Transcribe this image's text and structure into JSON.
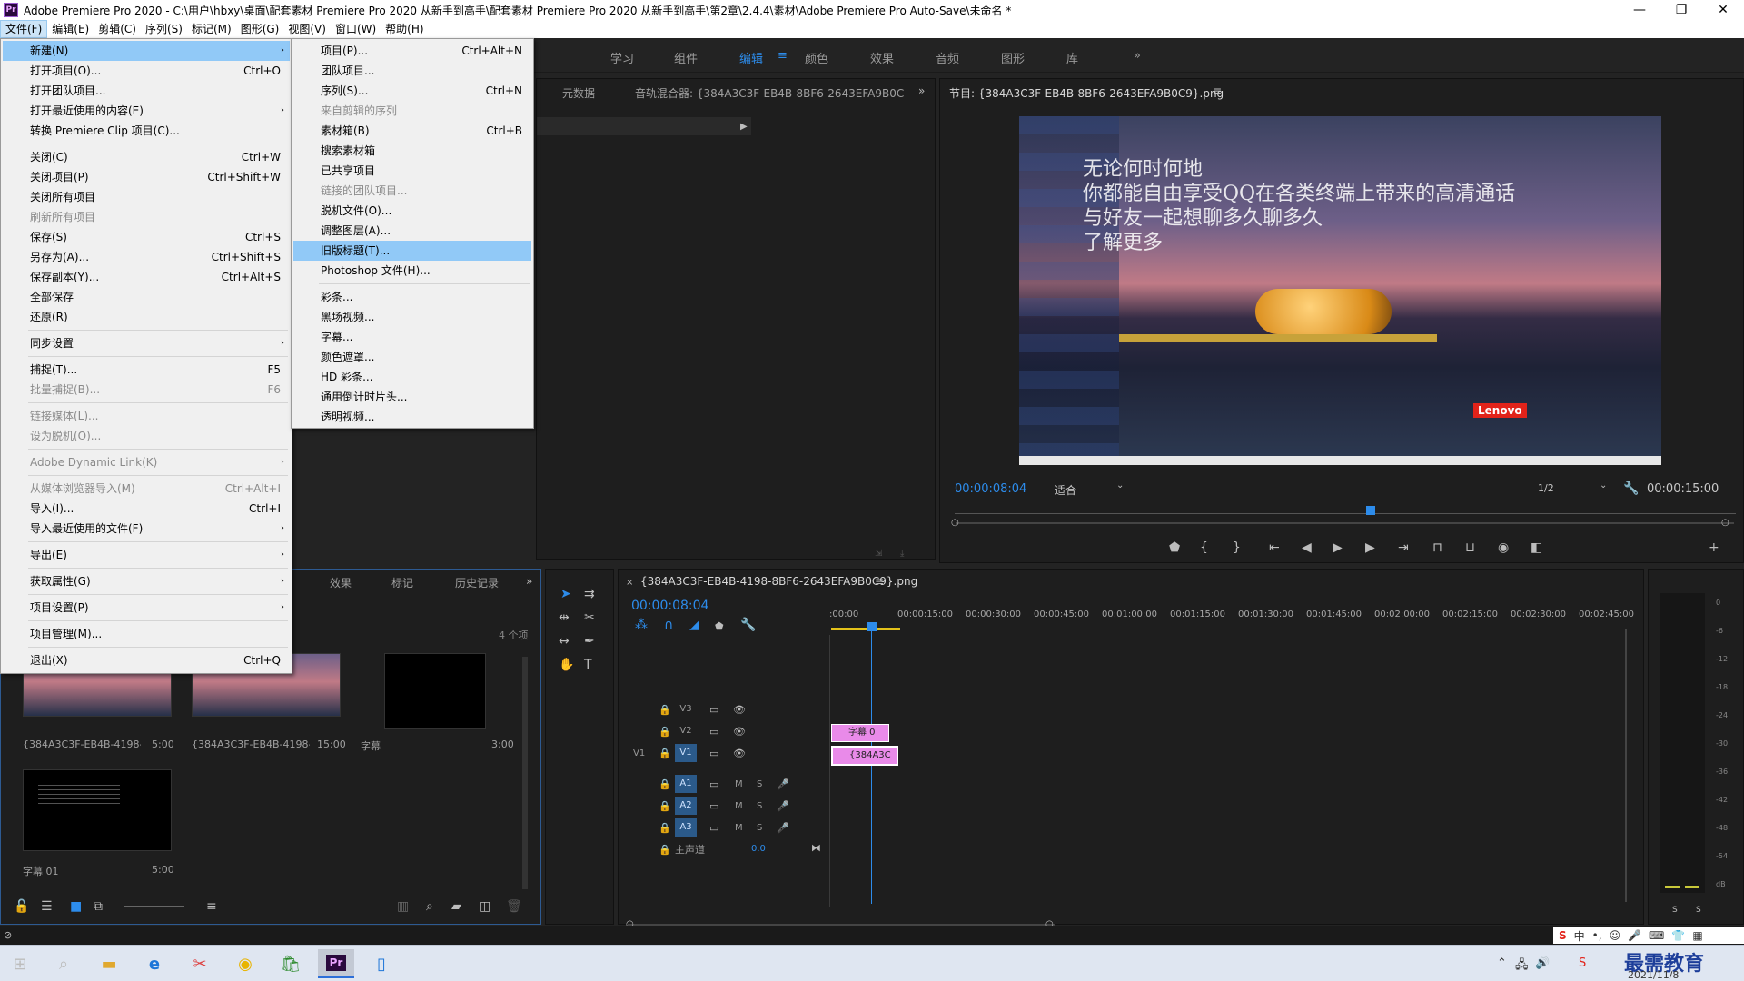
{
  "window": {
    "title": "Adobe Premiere Pro 2020 - C:\\用户\\hbxy\\桌面\\配套素材 Premiere Pro 2020 从新手到高手\\配套素材 Premiere Pro 2020 从新手到高手\\第2章\\2.4.4\\素材\\Adobe Premiere Pro Auto-Save\\未命名 *",
    "app_icon": "Pr",
    "minimize": "—",
    "maximize": "❐",
    "close": "✕"
  },
  "menubar": [
    "文件(F)",
    "编辑(E)",
    "剪辑(C)",
    "序列(S)",
    "标记(M)",
    "图形(G)",
    "视图(V)",
    "窗口(W)",
    "帮助(H)"
  ],
  "workspaces": [
    "学习",
    "组件",
    "编辑",
    "颜色",
    "效果",
    "音频",
    "图形",
    "库"
  ],
  "workspace_more": "»",
  "file_menu": [
    {
      "label": "新建(N)",
      "shortcut": "",
      "arrow": true,
      "state": "hl"
    },
    {
      "label": "打开项目(O)...",
      "shortcut": "Ctrl+O"
    },
    {
      "label": "打开团队项目...",
      "shortcut": ""
    },
    {
      "label": "打开最近使用的内容(E)",
      "shortcut": "",
      "arrow": true
    },
    {
      "label": "转换 Premiere Clip 项目(C)...",
      "shortcut": ""
    },
    {
      "sep": true
    },
    {
      "label": "关闭(C)",
      "shortcut": "Ctrl+W"
    },
    {
      "label": "关闭项目(P)",
      "shortcut": "Ctrl+Shift+W"
    },
    {
      "label": "关闭所有项目",
      "shortcut": ""
    },
    {
      "label": "刷新所有项目",
      "shortcut": "",
      "state": "dis"
    },
    {
      "label": "保存(S)",
      "shortcut": "Ctrl+S"
    },
    {
      "label": "另存为(A)...",
      "shortcut": "Ctrl+Shift+S"
    },
    {
      "label": "保存副本(Y)...",
      "shortcut": "Ctrl+Alt+S"
    },
    {
      "label": "全部保存",
      "shortcut": ""
    },
    {
      "label": "还原(R)",
      "shortcut": ""
    },
    {
      "sep": true
    },
    {
      "label": "同步设置",
      "shortcut": "",
      "arrow": true
    },
    {
      "sep": true
    },
    {
      "label": "捕捉(T)...",
      "shortcut": "F5"
    },
    {
      "label": "批量捕捉(B)...",
      "shortcut": "F6",
      "state": "dis"
    },
    {
      "sep": true
    },
    {
      "label": "链接媒体(L)...",
      "shortcut": "",
      "state": "dis"
    },
    {
      "label": "设为脱机(O)...",
      "shortcut": "",
      "state": "dis"
    },
    {
      "sep": true
    },
    {
      "label": "Adobe Dynamic Link(K)",
      "shortcut": "",
      "arrow": true,
      "state": "dis"
    },
    {
      "sep": true
    },
    {
      "label": "从媒体浏览器导入(M)",
      "shortcut": "Ctrl+Alt+I",
      "state": "dis"
    },
    {
      "label": "导入(I)...",
      "shortcut": "Ctrl+I"
    },
    {
      "label": "导入最近使用的文件(F)",
      "shortcut": "",
      "arrow": true
    },
    {
      "sep": true
    },
    {
      "label": "导出(E)",
      "shortcut": "",
      "arrow": true
    },
    {
      "sep": true
    },
    {
      "label": "获取属性(G)",
      "shortcut": "",
      "arrow": true
    },
    {
      "sep": true
    },
    {
      "label": "项目设置(P)",
      "shortcut": "",
      "arrow": true
    },
    {
      "sep": true
    },
    {
      "label": "项目管理(M)...",
      "shortcut": ""
    },
    {
      "sep": true
    },
    {
      "label": "退出(X)",
      "shortcut": "Ctrl+Q"
    }
  ],
  "new_submenu": [
    {
      "label": "项目(P)...",
      "shortcut": "Ctrl+Alt+N"
    },
    {
      "label": "团队项目...",
      "shortcut": ""
    },
    {
      "label": "序列(S)...",
      "shortcut": "Ctrl+N"
    },
    {
      "label": "来自剪辑的序列",
      "shortcut": "",
      "state": "dis"
    },
    {
      "label": "素材箱(B)",
      "shortcut": "Ctrl+B"
    },
    {
      "label": "搜索素材箱",
      "shortcut": ""
    },
    {
      "label": "已共享项目",
      "shortcut": ""
    },
    {
      "label": "链接的团队项目...",
      "shortcut": "",
      "state": "dis"
    },
    {
      "label": "脱机文件(O)...",
      "shortcut": ""
    },
    {
      "label": "调整图层(A)...",
      "shortcut": ""
    },
    {
      "label": "旧版标题(T)...",
      "shortcut": "",
      "state": "hl"
    },
    {
      "label": "Photoshop 文件(H)...",
      "shortcut": ""
    },
    {
      "sep": true
    },
    {
      "label": "彩条...",
      "shortcut": ""
    },
    {
      "label": "黑场视频...",
      "shortcut": ""
    },
    {
      "label": "字幕...",
      "shortcut": ""
    },
    {
      "label": "颜色遮罩...",
      "shortcut": ""
    },
    {
      "label": "HD 彩条...",
      "shortcut": ""
    },
    {
      "label": "通用倒计时片头...",
      "shortcut": ""
    },
    {
      "label": "透明视频...",
      "shortcut": ""
    }
  ],
  "source_panel": {
    "tabs": [
      "元数据",
      "音轨混合器: {384A3C3F-EB4B-8BF6-2643EFA9B0C"
    ]
  },
  "program": {
    "title": "节目: {384A3C3F-EB4B-8BF6-2643EFA9B0C9}.png",
    "current": "00:00:08:04",
    "fit": "适合",
    "resolution": "1/2",
    "duration": "00:00:15:00",
    "overlay_lines": [
      "无论何时何地",
      "你都能自由享受QQ在各类终端上带来的高清通话",
      "与好友一起想聊多久聊多久",
      "了解更多"
    ],
    "brand": "Lenovo"
  },
  "project_panel": {
    "tabs": [
      "效果",
      "标记",
      "历史记录"
    ],
    "count": "4 个项",
    "items": [
      {
        "name": "{384A3C3F-EB4B-4198-8...",
        "dur": "5:00"
      },
      {
        "name": "{384A3C3F-EB4B-4198-...",
        "dur": "15:00"
      },
      {
        "name": "字幕",
        "dur": "3:00"
      },
      {
        "name": "字幕 01",
        "dur": "5:00"
      }
    ]
  },
  "timeline": {
    "title": "{384A3C3F-EB4B-4198-8BF6-2643EFA9B0C9}.png",
    "current": "00:00:08:04",
    "ruler": [
      ":00:00",
      "00:00:15:00",
      "00:00:30:00",
      "00:00:45:00",
      "00:01:00:00",
      "00:01:15:00",
      "00:01:30:00",
      "00:01:45:00",
      "00:02:00:00",
      "00:02:15:00",
      "00:02:30:00",
      "00:02:45:00"
    ],
    "tracks": [
      "V3",
      "V2",
      "V1",
      "A1",
      "A2",
      "A3"
    ],
    "source_v1": "V1",
    "master": "主声道",
    "master_val": "0.0",
    "clip_v2": "字幕 0",
    "clip_v1": "{384A3C",
    "m": "M",
    "s": "S"
  },
  "meter": {
    "scale": [
      "0",
      "-6",
      "-12",
      "-18",
      "-24",
      "-30",
      "-36",
      "-42",
      "-48",
      "-54",
      "dB"
    ],
    "s1": "S",
    "s2": "S"
  },
  "taskbar": {
    "date": "2021/11/8",
    "watermark": "最需教育",
    "ime": "中"
  }
}
